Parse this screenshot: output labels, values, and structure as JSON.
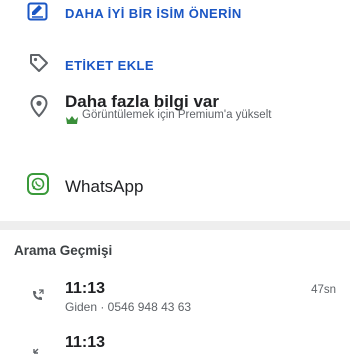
{
  "actions": {
    "suggest_name": "DAHA İYİ BİR İSİM ÖNERİN",
    "add_tag": "ETİKET EKLE"
  },
  "more_info": {
    "title": "Daha fazla bilgi var",
    "subtitle": "Görüntülemek için Premium'a yükselt"
  },
  "whatsapp": {
    "label": "WhatsApp"
  },
  "call_history": {
    "title": "Arama Geçmişi",
    "calls": [
      {
        "time": "11:13",
        "detail": "Giden · 0546 948 43 63",
        "duration": "47sn",
        "direction": "outgoing"
      },
      {
        "time": "11:13",
        "detail": "",
        "duration": "",
        "direction": "incoming"
      }
    ]
  },
  "colors": {
    "accent_blue": "#1a56c4",
    "icon_gray": "#5f6368",
    "premium_green": "#3a8f3a",
    "divider": "#eeeeee"
  },
  "icons": {
    "suggest_name": "edit-name-icon",
    "add_tag": "tag-icon",
    "more_info": "location-pin-icon",
    "whatsapp": "whatsapp-icon",
    "outgoing_call": "outgoing-call-icon",
    "incoming_call": "incoming-call-icon"
  }
}
